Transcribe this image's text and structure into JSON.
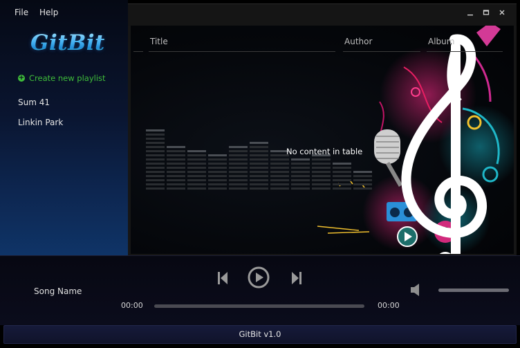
{
  "menu": {
    "file": "File",
    "help": "Help"
  },
  "app": {
    "logo": "GitBit"
  },
  "sidebar": {
    "create_playlist": "Create new playlist",
    "playlists": [
      "Sum 41",
      "Linkin Park"
    ]
  },
  "table": {
    "columns": [
      "Title",
      "Author",
      "Album"
    ],
    "empty_message": "No content in table"
  },
  "player": {
    "song_name": "Song Name",
    "elapsed": "00:00",
    "duration": "00:00",
    "progress": 0,
    "volume": 1.0
  },
  "statusbar": {
    "version": "GitBit v1.0"
  },
  "icons": {
    "previous": "skip-previous-icon",
    "play": "play-circle-icon",
    "next": "skip-next-icon",
    "volume": "speaker-icon",
    "add": "plus-circle-icon"
  },
  "colors": {
    "accent_green": "#3fbd3a",
    "treble_clef": "#ffffff",
    "logo_blue": "#51c2f1"
  }
}
